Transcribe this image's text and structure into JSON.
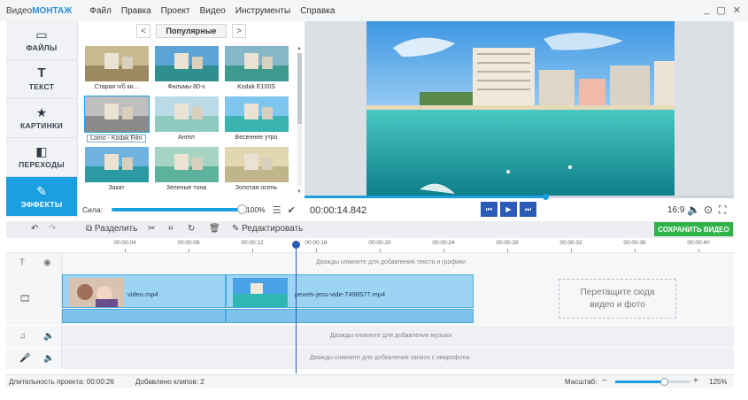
{
  "app": {
    "logo_prefix": "Видео",
    "logo_accent": "МОНТАЖ"
  },
  "menu": [
    "Файл",
    "Правка",
    "Проект",
    "Видео",
    "Инструменты",
    "Справка"
  ],
  "window_controls": {
    "minimize": "_",
    "restore": "▢",
    "close": "✕"
  },
  "sidebar": [
    {
      "label": "ФАЙЛЫ",
      "icon": "folder-icon",
      "glyph": "▭",
      "active": false
    },
    {
      "label": "ТЕКСТ",
      "icon": "text-icon",
      "glyph": "T",
      "active": false
    },
    {
      "label": "КАРТИНКИ",
      "icon": "star-icon",
      "glyph": "★",
      "active": false
    },
    {
      "label": "ПЕРЕХОДЫ",
      "icon": "transitions-icon",
      "glyph": "◧",
      "active": false
    },
    {
      "label": "ЭФФЕКТЫ",
      "icon": "effects-icon",
      "glyph": "✎",
      "active": true
    }
  ],
  "effects_panel": {
    "category": "Популярные",
    "prev_glyph": "<",
    "next_glyph": ">",
    "items": [
      {
        "label": "Старая ч/б ки...",
        "sky": "#c8b98f",
        "sea": "#9c8a62",
        "selected": false
      },
      {
        "label": "Фильмы 80-х",
        "sky": "#5ca3d6",
        "sea": "#2f8f8f",
        "selected": false
      },
      {
        "label": "Kodak E100S",
        "sky": "#86b7c9",
        "sea": "#3e9a8f",
        "selected": false
      },
      {
        "label": "Lomo - Kodak Film",
        "sky": "#bfbfbf",
        "sea": "#8a8a8a",
        "selected": true
      },
      {
        "label": "Ангел",
        "sky": "#b9dbe8",
        "sea": "#8fcabe",
        "selected": false
      },
      {
        "label": "Весеннее утро",
        "sky": "#7fc6ef",
        "sea": "#38b3b0",
        "selected": false
      },
      {
        "label": "Закат",
        "sky": "#6fb4e0",
        "sea": "#2b9aa3",
        "selected": false
      },
      {
        "label": "Зеленые тона",
        "sky": "#a6d3c2",
        "sea": "#5cb29a",
        "selected": false
      },
      {
        "label": "Золотая осень",
        "sky": "#e3d6b2",
        "sea": "#bfb48a",
        "selected": false
      }
    ],
    "strength_label": "Сила:",
    "strength_value": 100,
    "strength_text": "100%"
  },
  "player": {
    "timecode": "00:00:14.842",
    "progress": 0.56,
    "aspect": "16:9",
    "buttons": {
      "prev": "⏮",
      "play": "▶",
      "next": "⏭"
    }
  },
  "toolbar": {
    "split_label": "Разделить",
    "edit_label": "Редактировать",
    "save_label": "СОХРАНИТЬ ВИДЕО"
  },
  "ruler": [
    "00:00:04",
    "00:00:08",
    "00:00:12",
    "00:00:16",
    "00:00:20",
    "00:00:24",
    "00:00:28",
    "00:00:32",
    "00:00:36",
    "00:00:40"
  ],
  "timeline": {
    "text_hint": "Дважды кликните для добавления текста и графики",
    "clips": [
      {
        "name": "video.mp4"
      },
      {
        "name": "pexels-jess-vide-7498577.mp4"
      }
    ],
    "drop_text": "Перетащите сюда видео и фото",
    "music_hint": "Дважды кликните для добавления музыки",
    "mic_hint": "Дважды кликните для добавления записи с микрофона"
  },
  "status": {
    "duration": "Длительность проекта:  00:00:26",
    "clips_added": "Добавлено клипов: 2",
    "scale_label": "Масштаб:",
    "zoom_minus": "−",
    "zoom_plus": "+",
    "zoom_fraction": 0.65,
    "zoom_value": "125%"
  }
}
